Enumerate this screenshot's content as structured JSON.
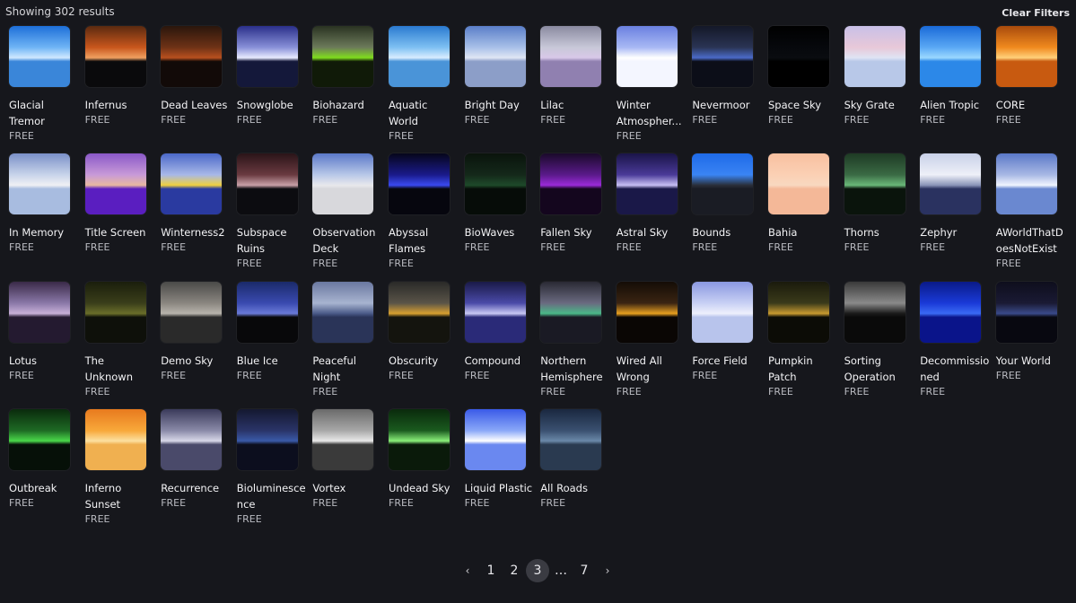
{
  "header": {
    "results_text": "Showing 302 results",
    "clear_filters_label": "Clear Filters"
  },
  "skyboxes": [
    {
      "name": "Glacial Tremor",
      "price": "FREE",
      "icon": "skybox-thumbnail",
      "colors": [
        "#1d6fd8",
        "#6fb4f5",
        "#cfe8ff",
        "#3a86d9"
      ]
    },
    {
      "name": "Infernus",
      "price": "FREE",
      "icon": "skybox-thumbnail",
      "colors": [
        "#5a2a10",
        "#c8561c",
        "#f0a060",
        "#0a0a0c"
      ]
    },
    {
      "name": "Dead Leaves",
      "price": "FREE",
      "icon": "skybox-thumbnail",
      "colors": [
        "#2a160c",
        "#6e3216",
        "#b8501e",
        "#120a08"
      ]
    },
    {
      "name": "Snowglobe",
      "price": "FREE",
      "icon": "skybox-thumbnail",
      "colors": [
        "#2a2f8a",
        "#8890d8",
        "#e8eaff",
        "#14183a"
      ]
    },
    {
      "name": "Biohazard",
      "price": "FREE",
      "icon": "skybox-thumbnail",
      "colors": [
        "#2a3322",
        "#6c7a5a",
        "#7fdc1e",
        "#101a08"
      ]
    },
    {
      "name": "Aquatic World",
      "price": "FREE",
      "icon": "skybox-thumbnail",
      "colors": [
        "#2a7ad0",
        "#7ec0f2",
        "#d8ecff",
        "#4a94d8"
      ]
    },
    {
      "name": "Bright Day",
      "price": "FREE",
      "icon": "skybox-thumbnail",
      "colors": [
        "#5a7ec8",
        "#a8c0e8",
        "#dfe6f4",
        "#8c9ec8"
      ]
    },
    {
      "name": "Lilac",
      "price": "FREE",
      "icon": "skybox-thumbnail",
      "colors": [
        "#8a8aa0",
        "#c8c8d8",
        "#d8c8e8",
        "#9080b0"
      ]
    },
    {
      "name": "Winter Atmospher...",
      "price": "FREE",
      "icon": "skybox-thumbnail",
      "colors": [
        "#6a80e0",
        "#a8b8f4",
        "#ffffff",
        "#f4f6ff"
      ]
    },
    {
      "name": "Nevermoor",
      "price": "FREE",
      "icon": "skybox-thumbnail",
      "colors": [
        "#141828",
        "#2a3454",
        "#4a6ac8",
        "#0c0e18"
      ]
    },
    {
      "name": "Space Sky",
      "price": "FREE",
      "icon": "skybox-thumbnail",
      "colors": [
        "#000000",
        "#06080c",
        "#0a0c10",
        "#000000"
      ]
    },
    {
      "name": "Sky Grate",
      "price": "FREE",
      "icon": "skybox-thumbnail",
      "colors": [
        "#c8c0e8",
        "#e8c8d8",
        "#dfe4f4",
        "#b8c8e8"
      ]
    },
    {
      "name": "Alien Tropic",
      "price": "FREE",
      "icon": "skybox-thumbnail",
      "colors": [
        "#1a6ad8",
        "#5aa8f4",
        "#9ad8ff",
        "#2c88e8"
      ]
    },
    {
      "name": "CORE",
      "price": "FREE",
      "icon": "skybox-thumbnail",
      "colors": [
        "#a84a0c",
        "#f08a1e",
        "#ffd07a",
        "#c85a10"
      ]
    },
    {
      "name": "In Memory",
      "price": "FREE",
      "icon": "skybox-thumbnail",
      "colors": [
        "#7a90c8",
        "#c8d4ea",
        "#f0f0f4",
        "#a8bce0"
      ]
    },
    {
      "name": "Title Screen",
      "price": "FREE",
      "icon": "skybox-thumbnail",
      "colors": [
        "#8a58c8",
        "#c89ad8",
        "#e8b8a0",
        "#5a1ec0"
      ]
    },
    {
      "name": "Winterness2",
      "price": "FREE",
      "icon": "skybox-thumbnail",
      "colors": [
        "#4a68c8",
        "#a8b8e8",
        "#f0d040",
        "#2a3aa0"
      ]
    },
    {
      "name": "Subspace Ruins",
      "price": "FREE",
      "icon": "skybox-thumbnail",
      "colors": [
        "#2a1418",
        "#6a3a40",
        "#c8a0a8",
        "#0c0c10"
      ]
    },
    {
      "name": "Observation Deck",
      "price": "FREE",
      "icon": "skybox-thumbnail",
      "colors": [
        "#5a78c8",
        "#b8c8e8",
        "#e8e8ec",
        "#d8d8dc"
      ]
    },
    {
      "name": "Abyssal Flames",
      "price": "FREE",
      "icon": "skybox-thumbnail",
      "colors": [
        "#06061a",
        "#1a1a8a",
        "#3a4af0",
        "#06060e"
      ]
    },
    {
      "name": "BioWaves",
      "price": "FREE",
      "icon": "skybox-thumbnail",
      "colors": [
        "#0a140c",
        "#14281a",
        "#1e4a2a",
        "#060c08"
      ]
    },
    {
      "name": "Fallen Sky",
      "price": "FREE",
      "icon": "skybox-thumbnail",
      "colors": [
        "#1a0a2a",
        "#5a1a8a",
        "#9a2ad8",
        "#14061e"
      ]
    },
    {
      "name": "Astral Sky",
      "price": "FREE",
      "icon": "skybox-thumbnail",
      "colors": [
        "#1a1448",
        "#4a3a98",
        "#c8c0f4",
        "#1a1848"
      ]
    },
    {
      "name": "Bounds",
      "price": "FREE",
      "icon": "skybox-thumbnail",
      "colors": [
        "#1e6ae8",
        "#3a84f4",
        "#2a2f3a",
        "#1a1c24"
      ]
    },
    {
      "name": "Bahia",
      "price": "FREE",
      "icon": "skybox-thumbnail",
      "colors": [
        "#f8c0a0",
        "#fbd0b4",
        "#f8d8c0",
        "#f4b898"
      ]
    },
    {
      "name": "Thorns",
      "price": "FREE",
      "icon": "skybox-thumbnail",
      "colors": [
        "#1e3a24",
        "#3a6a44",
        "#6ab878",
        "#0a140c"
      ]
    },
    {
      "name": "Zephyr",
      "price": "FREE",
      "icon": "skybox-thumbnail",
      "colors": [
        "#c8d0e8",
        "#eef0f8",
        "#8a94b8",
        "#2a3260"
      ]
    },
    {
      "name": "AWorldThatDoesNotExist",
      "price": "FREE",
      "icon": "skybox-thumbnail",
      "colors": [
        "#5a78c8",
        "#a8b8e4",
        "#f0f4ff",
        "#6a88d0"
      ]
    },
    {
      "name": "Lotus",
      "price": "FREE",
      "icon": "skybox-thumbnail",
      "colors": [
        "#3a2a48",
        "#8a78a8",
        "#c8b0d8",
        "#241a30"
      ]
    },
    {
      "name": "The Unknown",
      "price": "FREE",
      "icon": "skybox-thumbnail",
      "colors": [
        "#1a1e0c",
        "#3a3e1a",
        "#6a6e2a",
        "#0e100a"
      ]
    },
    {
      "name": "Demo Sky",
      "price": "FREE",
      "icon": "skybox-thumbnail",
      "colors": [
        "#4a4a48",
        "#8a8680",
        "#b8b4ac",
        "#2a2a2a"
      ]
    },
    {
      "name": "Blue Ice",
      "price": "FREE",
      "icon": "skybox-thumbnail",
      "colors": [
        "#1a2a6a",
        "#3a4ab0",
        "#6a7ad8",
        "#08080a"
      ]
    },
    {
      "name": "Peaceful Night",
      "price": "FREE",
      "icon": "skybox-thumbnail",
      "colors": [
        "#6a78a0",
        "#a8b4d0",
        "#4a5a88",
        "#2a3458"
      ]
    },
    {
      "name": "Obscurity",
      "price": "FREE",
      "icon": "skybox-thumbnail",
      "colors": [
        "#2a2a28",
        "#5a5448",
        "#d8a030",
        "#14140e"
      ]
    },
    {
      "name": "Compound",
      "price": "FREE",
      "icon": "skybox-thumbnail",
      "colors": [
        "#1a1a48",
        "#4a4aa8",
        "#c8c8f4",
        "#2a2a78"
      ]
    },
    {
      "name": "Northern Hemisphere",
      "price": "FREE",
      "icon": "skybox-thumbnail",
      "colors": [
        "#2a2a34",
        "#6a6a80",
        "#4ab888",
        "#1a1a24"
      ]
    },
    {
      "name": "Wired All Wrong",
      "price": "FREE",
      "icon": "skybox-thumbnail",
      "colors": [
        "#140c06",
        "#3a2412",
        "#e8a020",
        "#0a0604"
      ]
    },
    {
      "name": "Force Field",
      "price": "FREE",
      "icon": "skybox-thumbnail",
      "colors": [
        "#8a98e0",
        "#c8d0f4",
        "#eef0fc",
        "#b8c4ec"
      ]
    },
    {
      "name": "Pumpkin Patch",
      "price": "FREE",
      "icon": "skybox-thumbnail",
      "colors": [
        "#1a1a0c",
        "#3a3a1a",
        "#c89a30",
        "#0c0c06"
      ]
    },
    {
      "name": "Sorting Operation",
      "price": "FREE",
      "icon": "skybox-thumbnail",
      "colors": [
        "#3a3a3a",
        "#8a8a8a",
        "#1a1a1a",
        "#0a0a0a"
      ]
    },
    {
      "name": "Decommissioned",
      "price": "FREE",
      "icon": "skybox-thumbnail",
      "colors": [
        "#0a1a88",
        "#1a3ad8",
        "#3a6af4",
        "#0a148a"
      ]
    },
    {
      "name": "Your World",
      "price": "FREE",
      "icon": "skybox-thumbnail",
      "colors": [
        "#0e0e1c",
        "#1a1a34",
        "#3a4a8a",
        "#080810"
      ]
    },
    {
      "name": "Outbreak",
      "price": "FREE",
      "icon": "skybox-thumbnail",
      "colors": [
        "#0a2a0c",
        "#1e6a24",
        "#4ad84a",
        "#061008"
      ]
    },
    {
      "name": "Inferno Sunset",
      "price": "FREE",
      "icon": "skybox-thumbnail",
      "colors": [
        "#e87a1e",
        "#f8a83a",
        "#fce0a0",
        "#f0b050"
      ]
    },
    {
      "name": "Recurrence",
      "price": "FREE",
      "icon": "skybox-thumbnail",
      "colors": [
        "#3a3a5a",
        "#8a8aa8",
        "#d8d8e8",
        "#4a4a6a"
      ]
    },
    {
      "name": "Bioluminescence",
      "price": "FREE",
      "icon": "skybox-thumbnail",
      "colors": [
        "#141830",
        "#2a3468",
        "#3a5aa8",
        "#0c0e1e"
      ]
    },
    {
      "name": "Vortex",
      "price": "FREE",
      "icon": "skybox-thumbnail",
      "colors": [
        "#6a6a6a",
        "#a8a8a8",
        "#e8e8e8",
        "#3a3a3a"
      ]
    },
    {
      "name": "Undead Sky",
      "price": "FREE",
      "icon": "skybox-thumbnail",
      "colors": [
        "#0a2a0c",
        "#1a5a1e",
        "#8af07a",
        "#0a1a0a"
      ]
    },
    {
      "name": "Liquid Plastic",
      "price": "FREE",
      "icon": "skybox-thumbnail",
      "colors": [
        "#3a5ae8",
        "#8aa8f8",
        "#ffffff",
        "#6a88f0"
      ]
    },
    {
      "name": "All Roads",
      "price": "FREE",
      "icon": "skybox-thumbnail",
      "colors": [
        "#1a2840",
        "#3a5070",
        "#6a88a8",
        "#2a3a50"
      ]
    }
  ],
  "pagination": {
    "prev_icon": "chevron-left-icon",
    "prev_glyph": "‹",
    "pages": [
      "1",
      "2",
      "3",
      "…",
      "7"
    ],
    "active_page": "3",
    "next_icon": "chevron-right-icon",
    "next_glyph": "›",
    "active_bg": "#3a3b42"
  }
}
